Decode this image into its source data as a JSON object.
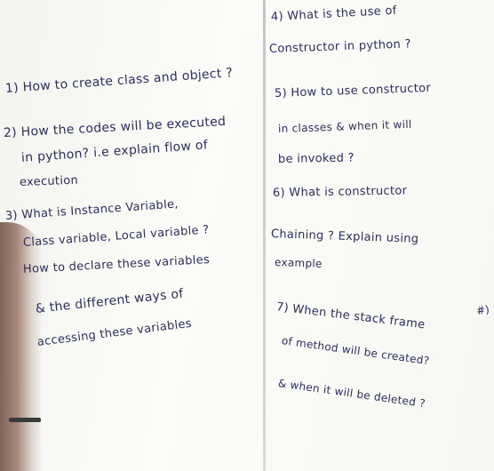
{
  "board": {
    "left_lines": [
      "1) How to create class and object ?",
      "2) How the codes will be executed",
      "in python? i.e explain flow of",
      "execution",
      "3) What is Instance Variable,",
      "Class variable, Local variable ?",
      "How to declare these variables",
      "& the different ways of",
      "accessing these variables"
    ],
    "right_lines": [
      "4) What is the use of",
      "Constructor in python ?",
      "5) How to use constructor",
      "in classes & when it will",
      "be invoked ?",
      "6) What is constructor",
      "Chaining ? Explain using",
      "example",
      "7) When the stack frame",
      "of method will be created?",
      "& when it will be deleted ?"
    ],
    "margin_mark": "#)"
  }
}
